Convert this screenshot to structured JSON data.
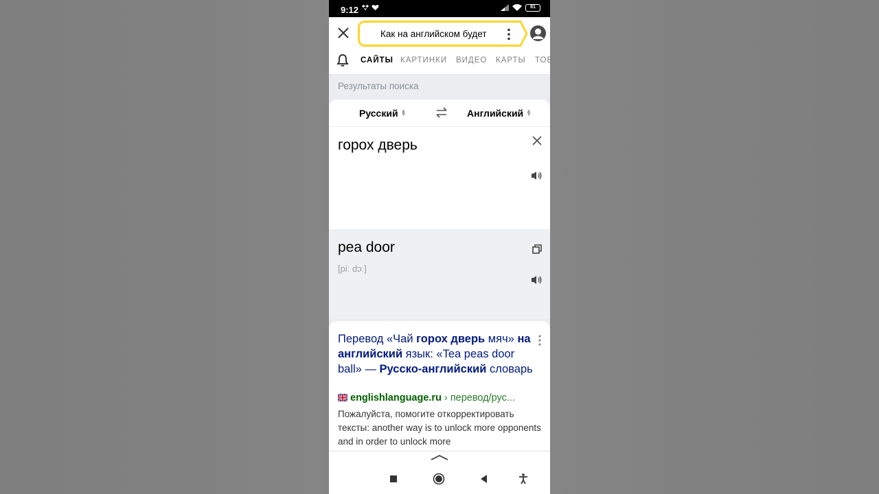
{
  "status_bar": {
    "time": "9:12",
    "battery": "81"
  },
  "search": {
    "query": "Как на английском будет"
  },
  "tabs": [
    {
      "label": "САЙТЫ",
      "active": true
    },
    {
      "label": "КАРТИНКИ",
      "active": false
    },
    {
      "label": "ВИДЕО",
      "active": false
    },
    {
      "label": "КАРТЫ",
      "active": false
    },
    {
      "label": "ТОВ",
      "active": false
    }
  ],
  "results_label": "Результаты поиска",
  "translator": {
    "source_lang": "Русский",
    "target_lang": "Английский",
    "source_text": "горох дверь",
    "target_text": "pea door",
    "transcription": "[piː dɔː]"
  },
  "result": {
    "title_parts": [
      {
        "text": "Перевод «Чай ",
        "bold": false
      },
      {
        "text": "горох дверь",
        "bold": true
      },
      {
        "text": " мяч» ",
        "bold": false
      },
      {
        "text": "на английский",
        "bold": true
      },
      {
        "text": " язык: «Tea peas door ball» — ",
        "bold": false
      },
      {
        "text": "Русско-английский",
        "bold": true
      },
      {
        "text": " словарь",
        "bold": false
      }
    ],
    "url_host": "englishlanguage.ru",
    "url_path": " › перевод/рус...",
    "snippet": "Пожалуйста, помогите откорректировать тексты: another way is to unlock more opponents and in order to unlock more"
  },
  "colors": {
    "accent_yellow": "#fed42b",
    "link_blue": "#001a80",
    "url_green": "#006000"
  },
  "icons": {
    "close": "close-icon",
    "menu": "kebab-menu-icon",
    "avatar": "avatar-icon",
    "bell": "bell-icon",
    "swap": "swap-icon",
    "clear": "clear-icon",
    "speaker": "speaker-icon",
    "copy": "copy-icon",
    "flag": "uk-flag-icon"
  }
}
